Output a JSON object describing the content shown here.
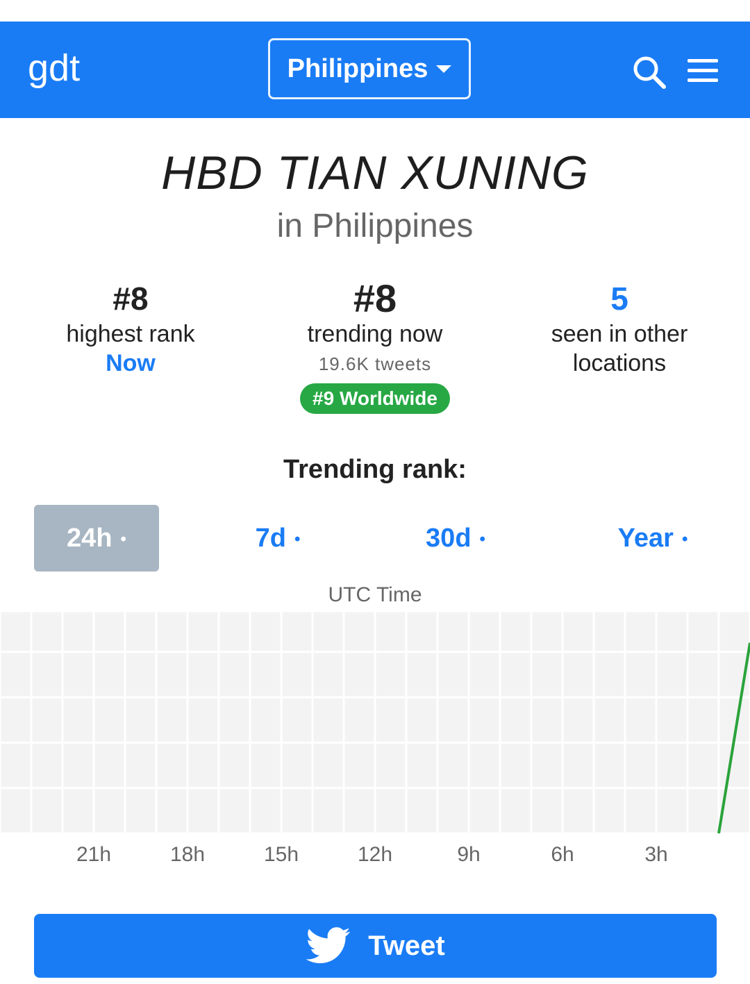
{
  "navbar": {
    "logo": "gdt",
    "country": "Philippines",
    "icons": [
      "search-icon",
      "menu-icon"
    ],
    "color": "#1a7cf5"
  },
  "trend": {
    "title": "HBD TIAN XUNING",
    "location": "in Philippines"
  },
  "stats": {
    "highest": {
      "value": "#8",
      "label": "highest rank",
      "when": "Now"
    },
    "current": {
      "value": "#8",
      "label": "trending now",
      "tweets": "19.6K tweets",
      "worldwide": "#9 Worldwide"
    },
    "other": {
      "value": "5",
      "label_line1": "seen in other",
      "label_line2": "locations"
    }
  },
  "rank_section": {
    "title": "Trending rank:",
    "tabs": [
      {
        "label": "24h",
        "active": true
      },
      {
        "label": "7d",
        "active": false
      },
      {
        "label": "30d",
        "active": false
      },
      {
        "label": "Year",
        "active": false
      }
    ],
    "dot": "•"
  },
  "chart_data": {
    "type": "line",
    "title": "",
    "xlabel": "UTC Time",
    "ylabel": "",
    "x_ticks": [
      "21h",
      "18h",
      "15h",
      "12h",
      "9h",
      "6h",
      "3h"
    ],
    "xlim": [
      24,
      0
    ],
    "ylim": [
      50,
      1
    ],
    "grid": true,
    "series": [
      {
        "color": "#2aa33b",
        "points": [
          {
            "x": 0.0,
            "y": 8
          },
          {
            "x": 1.0,
            "y": 50
          }
        ]
      }
    ]
  },
  "tweet_button": {
    "label": "Tweet",
    "icon": "twitter-bird-icon",
    "color": "#1a7cf5"
  }
}
